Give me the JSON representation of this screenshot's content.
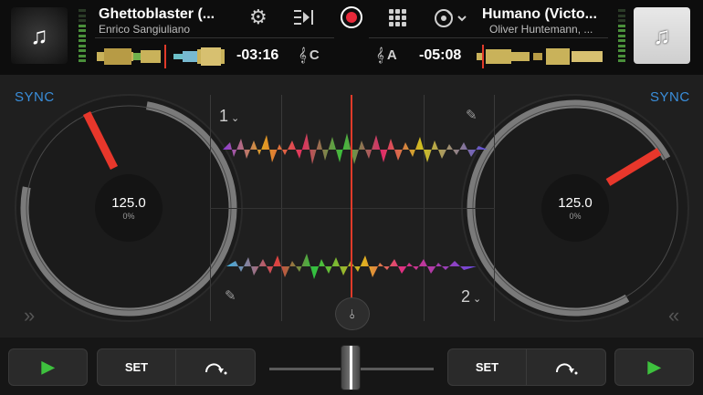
{
  "deck_left": {
    "title": "Ghettoblaster (...",
    "artist": "Enrico Sangiuliano",
    "time": "-03:16",
    "key": "C",
    "bpm": "125.0",
    "pitch": "0%",
    "sync_label": "SYNC",
    "deck_number": "1",
    "set_label": "SET"
  },
  "deck_right": {
    "title": "Humano (Victo...",
    "artist": "Oliver Huntemann, ...",
    "time": "-05:08",
    "key": "A",
    "bpm": "125.0",
    "pitch": "0%",
    "sync_label": "SYNC",
    "deck_number": "2",
    "set_label": "SET"
  },
  "icons": {
    "settings": "gear-icon",
    "record": "record-icon",
    "grid": "grid-icon",
    "vinyl": "vinyl-icon",
    "music": "music-note-icon",
    "key": "key-clef-icon",
    "pencil": "pencil-icon",
    "loop": "loop-icon",
    "play": "play-icon",
    "mixer": "mixer-icon"
  },
  "colors": {
    "accent": "#3a8edb",
    "playhead": "#e03a2a",
    "play": "#3ec13e",
    "record": "#e8293a"
  }
}
